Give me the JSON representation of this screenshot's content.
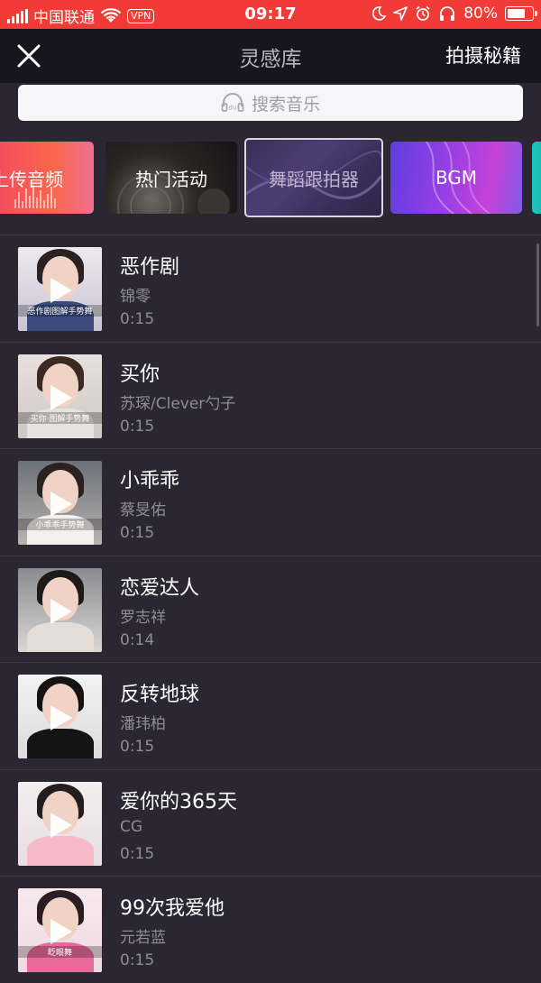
{
  "status_bar": {
    "carrier": "中国联通",
    "vpn": "VPN",
    "time": "09:17",
    "battery_percent": "80%",
    "battery_level": 0.8
  },
  "nav": {
    "title": "灵感库",
    "right_label": "拍摄秘籍"
  },
  "search": {
    "placeholder": "搜索音乐"
  },
  "categories": [
    {
      "label": "上传音频"
    },
    {
      "label": "热门活动"
    },
    {
      "label": "舞蹈跟拍器"
    },
    {
      "label": "BGM"
    }
  ],
  "songs": [
    {
      "title": "恶作剧",
      "artist": "锦零",
      "duration": "0:15",
      "caption": "恶作剧图解手势舞"
    },
    {
      "title": "买你",
      "artist": "苏琛/Clever勺子",
      "duration": "0:15",
      "caption": "买你·图解手势舞"
    },
    {
      "title": "小乖乖",
      "artist": "蔡旻佑",
      "duration": "0:15",
      "caption": "小乖乖手势舞"
    },
    {
      "title": "恋爱达人",
      "artist": "罗志祥",
      "duration": "0:14",
      "caption": ""
    },
    {
      "title": "反转地球",
      "artist": "潘玮柏",
      "duration": "0:15",
      "caption": ""
    },
    {
      "title": "爱你的365天",
      "artist": "CG",
      "duration": "0:15",
      "caption": ""
    },
    {
      "title": "99次我爱他",
      "artist": "元若蓝",
      "duration": "0:15",
      "caption": "眨眼舞"
    }
  ],
  "colors": {
    "status_bar": "#f23b36",
    "nav_bg": "#161520",
    "page_bg": "#2a2733"
  }
}
